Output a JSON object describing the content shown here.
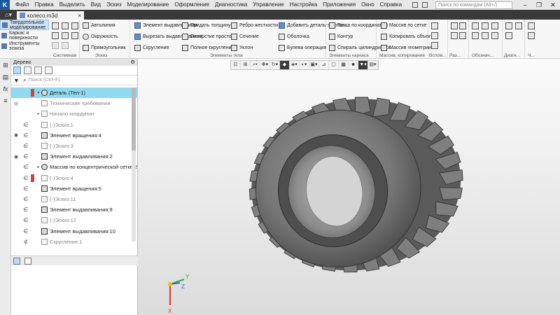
{
  "app": {
    "logo": "K",
    "menu": [
      "Файл",
      "Правка",
      "Выделить",
      "Вид",
      "Эскиз",
      "Моделирование",
      "Оформление",
      "Диагностика",
      "Управление",
      "Настройка",
      "Приложения",
      "Окно",
      "Справка"
    ],
    "command_search_placeholder": "Поиск по командам (Alt+/)"
  },
  "tab": {
    "doc_name": "колесо.m3d",
    "close": "×"
  },
  "ribbon": {
    "modes": [
      "Твердотельное моделирование",
      "Каркас и поверхности",
      "Инструменты эскиза"
    ],
    "sketch": {
      "items": [
        "Автолиния",
        "Окружность",
        "Прямоугольник"
      ],
      "label": "Эскиз"
    },
    "system_label": "Системная",
    "body": {
      "items": [
        "Элемент выдавливания",
        "Вырезать выдавливанием",
        "Скругление",
        "Придать толщину",
        "Отверстие простое",
        "Полное скругление",
        "Ребро жесткости",
        "Сечение",
        "Уклон",
        "Добавить деталь-заготов...",
        "Оболочка",
        "Булева операция"
      ],
      "label": "Элементы тела"
    },
    "line": {
      "items": [
        "Точка по координатам",
        "Контур",
        "Спираль цилиндрическ..."
      ],
      "label": "Элементы каркаса"
    },
    "array": {
      "items": [
        "Массив по сетке",
        "Копировать объекты",
        "Массив геометрии"
      ],
      "label": "Массив, копирование"
    },
    "small_labels": [
      "Вспом...",
      "Раз...",
      "Обознач...",
      "Диагн...",
      "Ч..."
    ]
  },
  "tree": {
    "title": "Дерево",
    "search_placeholder": "Поиск (Ctrl+F)",
    "rows": [
      {
        "label": "Деталь (Тел-1)"
      },
      {
        "label": "Технические требования"
      },
      {
        "label": "Начало координат"
      },
      {
        "label": "(-)Эскиз:1"
      },
      {
        "label": "Элемент вращения:4"
      },
      {
        "label": "(-)Эскиз:3"
      },
      {
        "label": "Элемент выдавливания:2"
      },
      {
        "label": "Массив по концентрической сетке:2"
      },
      {
        "label": "(-)Эскиз:4"
      },
      {
        "label": "Элемент вращения:5"
      },
      {
        "label": "(-)Эскиз:11"
      },
      {
        "label": "Элемент выдавливания:9"
      },
      {
        "label": "(-)Эскиз:12"
      },
      {
        "label": "Элемент выдавливания:10"
      },
      {
        "label": "Скругление:1"
      }
    ]
  },
  "axes": {
    "x": "X",
    "y": "Y",
    "z": "Z"
  },
  "colors": {
    "accent": "#1a5aa0",
    "selection": "#8fdaf0",
    "tire": "#6d6d6d"
  }
}
